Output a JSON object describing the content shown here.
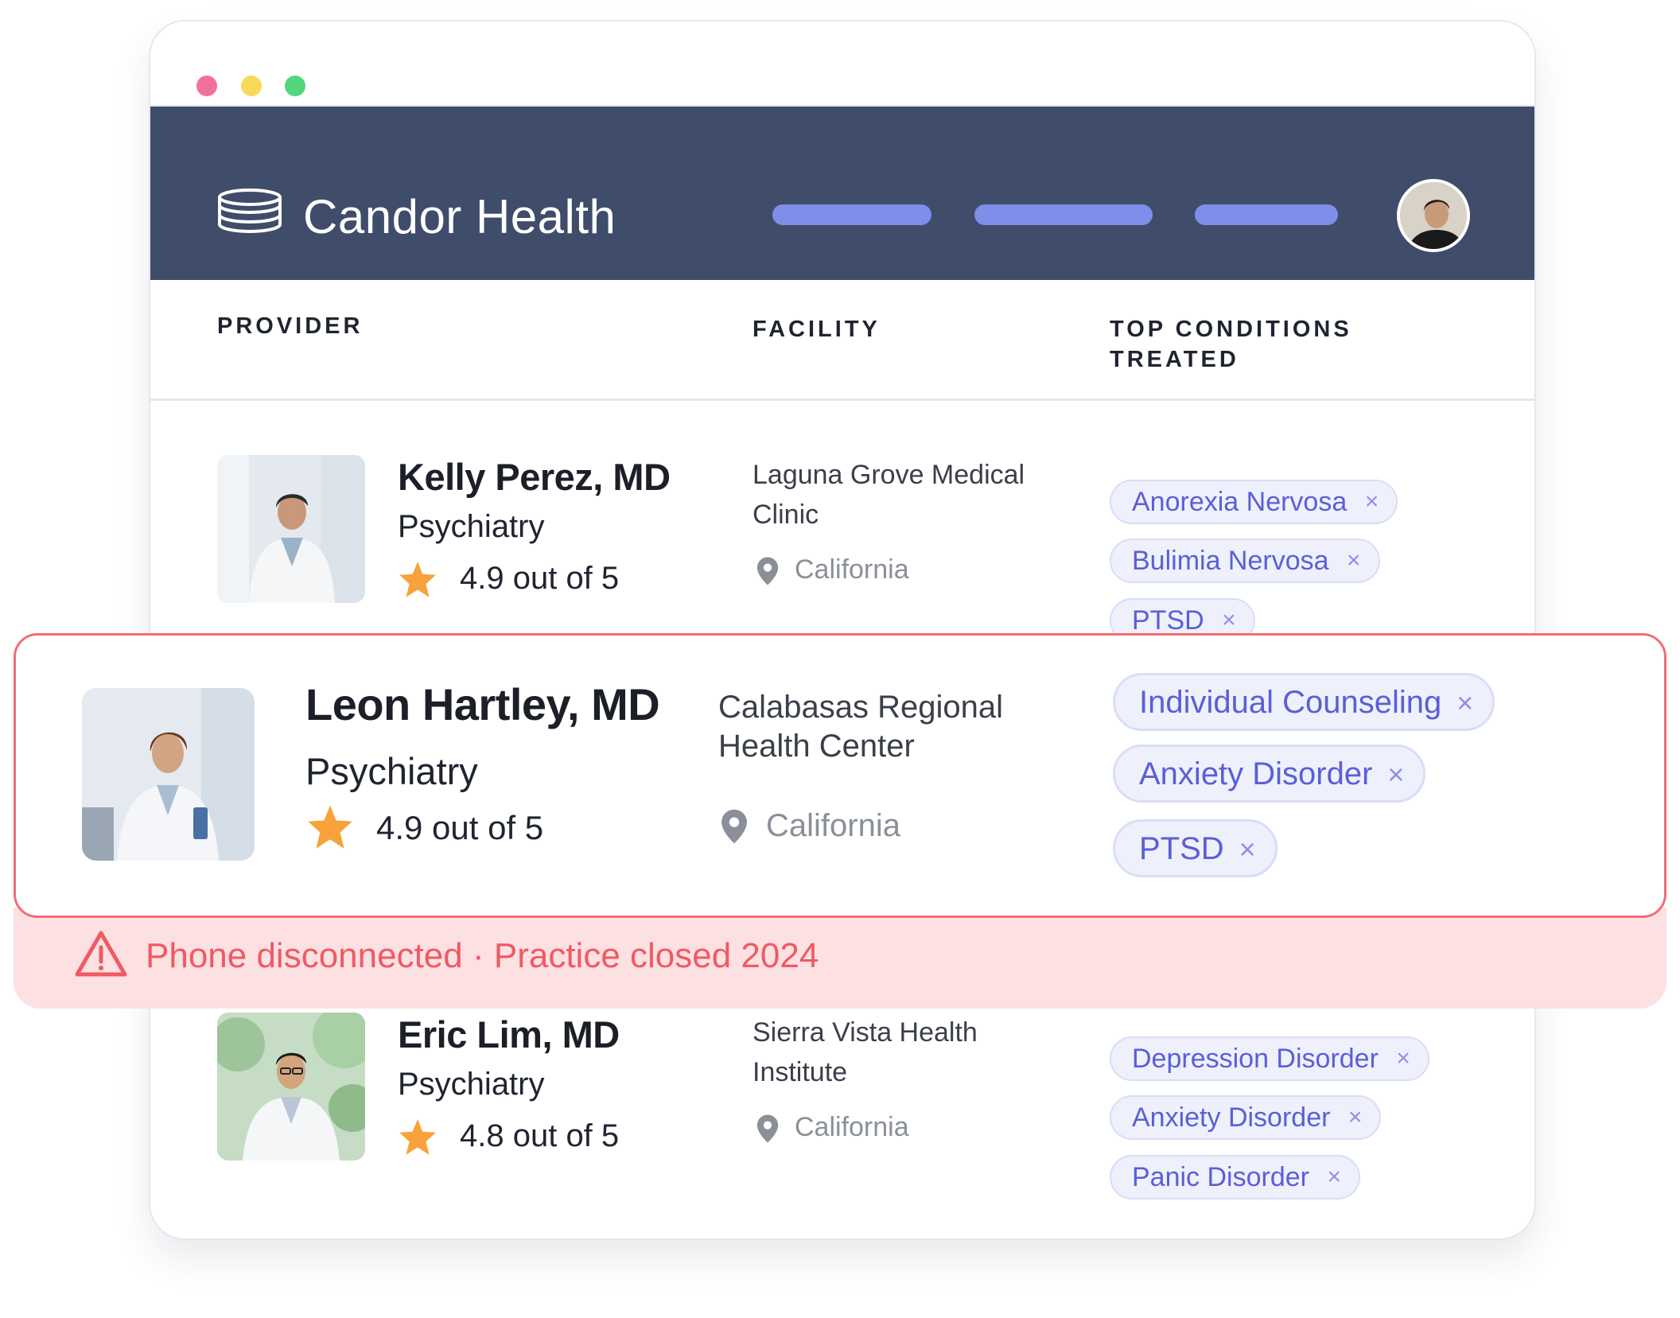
{
  "window": {
    "traffic_lights": [
      "close",
      "minimize",
      "zoom"
    ]
  },
  "header": {
    "brand": "Candor Health",
    "logo_icon": "stacked-discs-icon",
    "nav_placeholders": 3,
    "avatar": "user-avatar"
  },
  "columns": {
    "provider": "PROVIDER",
    "facility": "FACILITY",
    "conditions_line1": "TOP CONDITIONS",
    "conditions_line2": "TREATED"
  },
  "providers": [
    {
      "name": "Kelly Perez, MD",
      "specialty": "Psychiatry",
      "rating": "4.9 out of 5",
      "facility_line1": "Laguna Grove Medical",
      "facility_line2": "Clinic",
      "location": "California",
      "conditions": [
        "Anorexia Nervosa",
        "Bulimia Nervosa",
        "PTSD"
      ]
    },
    {
      "name": "Leon Hartley, MD",
      "specialty": "Psychiatry",
      "rating": "4.9 out of 5",
      "facility_line1": "Calabasas Regional",
      "facility_line2": "Health Center",
      "location": "California",
      "conditions": [
        "Individual Counseling",
        "Anxiety Disorder",
        "PTSD"
      ],
      "warning": "Phone disconnected · Practice closed 2024"
    },
    {
      "name": "Eric Lim, MD",
      "specialty": "Psychiatry",
      "rating": "4.8 out of 5",
      "facility_line1": "Sierra Vista Health",
      "facility_line2": "Institute",
      "location": "California",
      "conditions": [
        "Depression Disorder",
        "Anxiety Disorder",
        "Panic Disorder"
      ]
    }
  ],
  "tag_remove_glyph": "×",
  "colors": {
    "header_bg": "#3f4d6b",
    "nav_placeholder": "#7f8ee8",
    "tag_text": "#5a5fd6",
    "tag_bg": "#eef0fc",
    "star": "#f7a23b",
    "alert": "#ef5a63",
    "alert_bg": "#fde0e2"
  }
}
